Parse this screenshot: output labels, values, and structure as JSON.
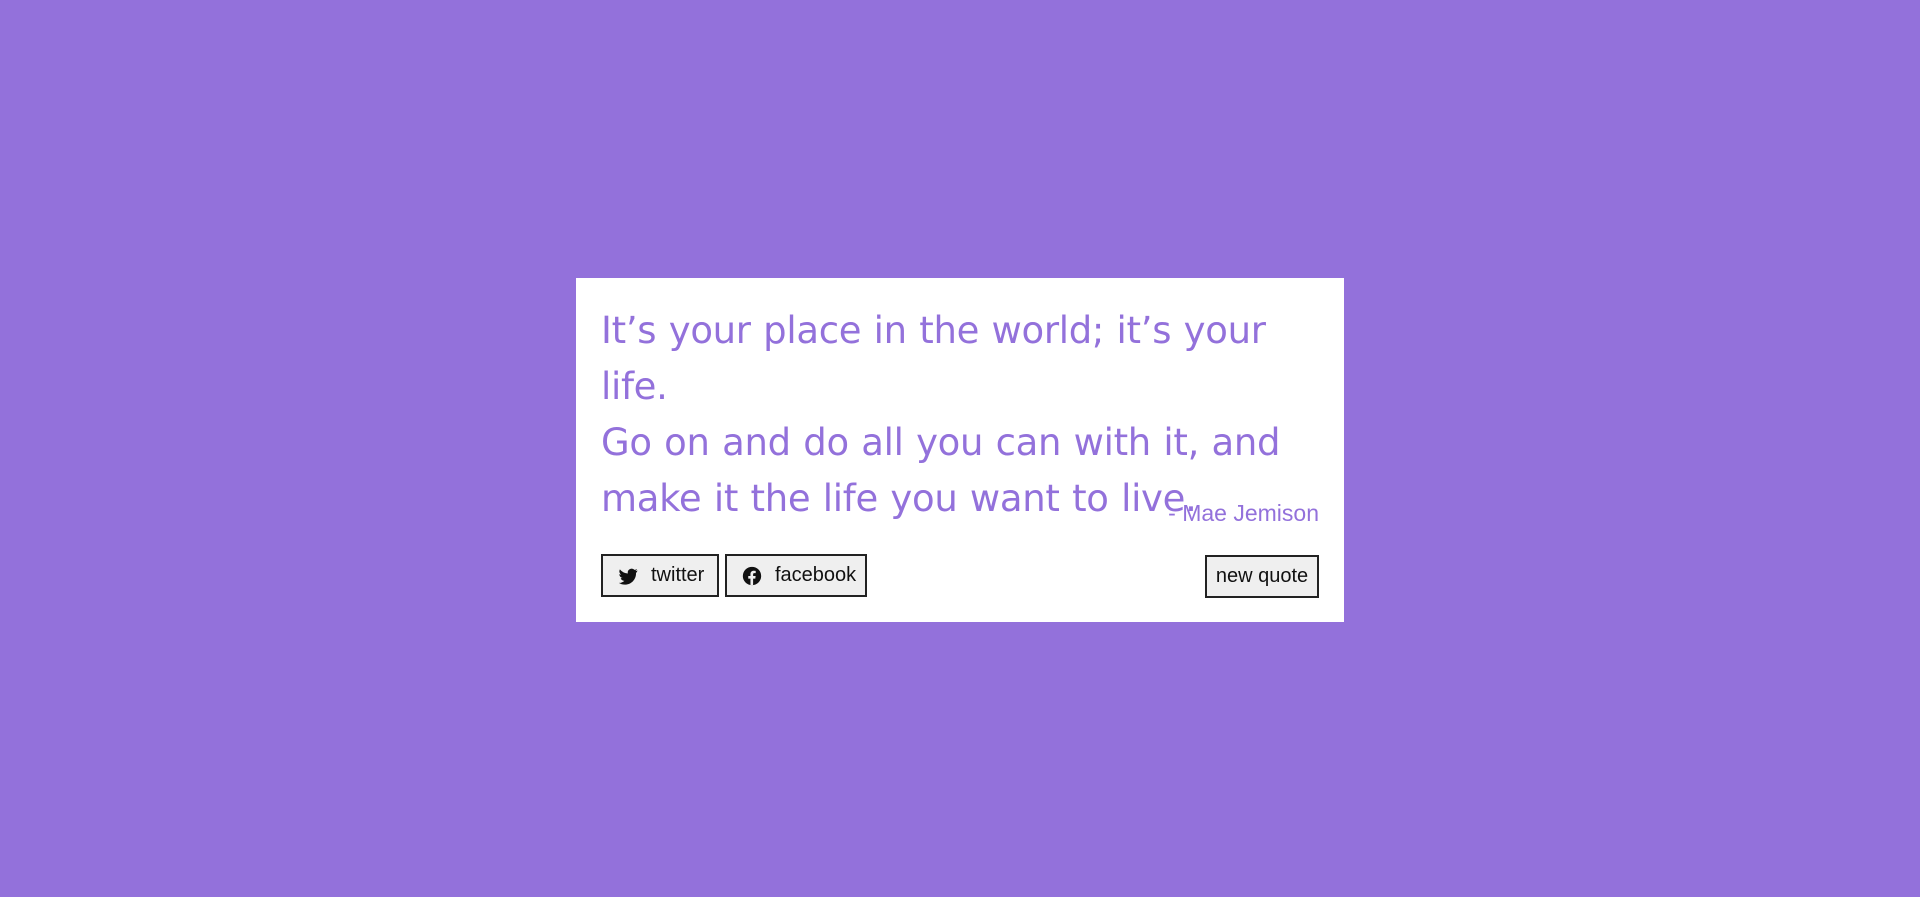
{
  "page": {
    "background_color": "#9371db"
  },
  "quote": {
    "line1": "It’s your place in the world; it’s your life.",
    "line2": "Go on and do all you can with it, and",
    "line3": "make it the life you want to live.",
    "author": "- Mae Jemison",
    "text_color": "#9371db"
  },
  "buttons": {
    "twitter": {
      "label": "twitter",
      "icon": "twitter-icon"
    },
    "facebook": {
      "label": "facebook",
      "icon": "facebook-icon"
    },
    "new_quote": {
      "label": "new quote"
    }
  }
}
